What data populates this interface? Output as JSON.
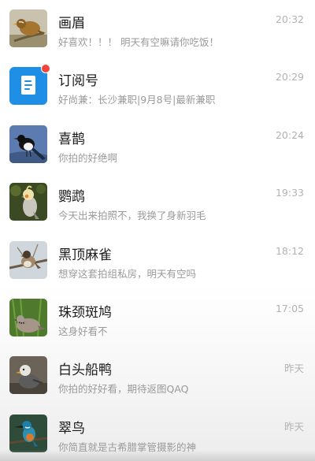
{
  "chats": [
    {
      "name": "画眉",
      "time": "20:32",
      "preview": "好喜欢！！！ 明天有空嘛请你吃饭！",
      "avatar_icon": "thrush-bird-photo",
      "unread_dot": false
    },
    {
      "name": "订阅号",
      "time": "20:29",
      "preview": "好尚兼：长沙兼职|9月8号|最新兼职",
      "avatar_icon": "subscription-account-icon",
      "unread_dot": true
    },
    {
      "name": "喜鹊",
      "time": "20:24",
      "preview": "你拍的好绝啊",
      "avatar_icon": "magpie-bird-photo",
      "unread_dot": false
    },
    {
      "name": "鹦鹉",
      "time": "19:33",
      "preview": "今天出来拍照不，我换了身新羽毛",
      "avatar_icon": "cockatiel-bird-photo",
      "unread_dot": false
    },
    {
      "name": "黑顶麻雀",
      "time": "18:12",
      "preview": "想穿这套拍组私房，明天有空吗",
      "avatar_icon": "sparrow-bird-photo",
      "unread_dot": false
    },
    {
      "name": "珠颈斑鸠",
      "time": "17:05",
      "preview": "这身好看不",
      "avatar_icon": "dove-bird-photo",
      "unread_dot": false
    },
    {
      "name": "白头船鸭",
      "time": "昨天",
      "preview": "你拍的好好看，期待返图QAQ",
      "avatar_icon": "steamer-duck-photo",
      "unread_dot": false
    },
    {
      "name": "翠鸟",
      "time": "昨天",
      "preview": "你简直就是古希腊掌管摄影的神",
      "avatar_icon": "kingfisher-bird-photo",
      "unread_dot": false
    }
  ],
  "colors": {
    "app_icon_blue": "#1f8fe6",
    "unread_dot_red": "#f0453d",
    "name_text": "#1b1b1b",
    "secondary_text": "#9a9a9a"
  }
}
